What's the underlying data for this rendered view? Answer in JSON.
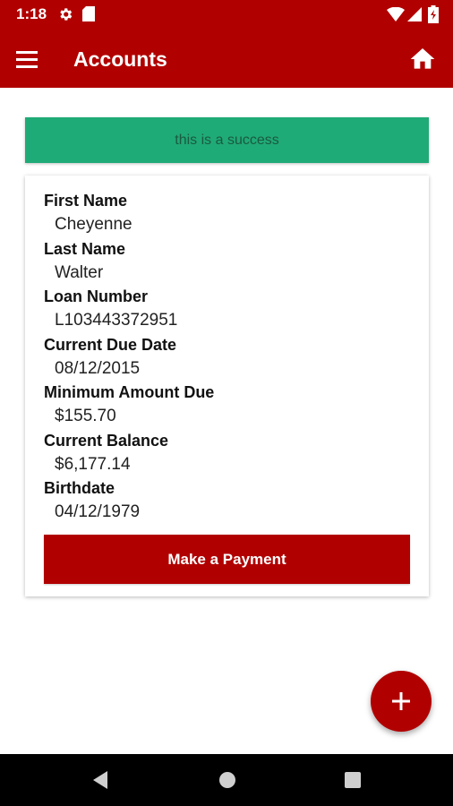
{
  "status_bar": {
    "time": "1:18",
    "icons": [
      "settings-gear-icon",
      "sd-card-icon",
      "wifi-icon",
      "cell-signal-icon",
      "battery-charging-icon"
    ]
  },
  "app_bar": {
    "title": "Accounts",
    "icons": [
      "menu-icon",
      "home-icon"
    ]
  },
  "alert": {
    "message": "this is a success",
    "color": "#1fab77"
  },
  "account": {
    "fields": [
      {
        "label": "First Name",
        "value": "Cheyenne"
      },
      {
        "label": "Last Name",
        "value": "Walter"
      },
      {
        "label": "Loan Number",
        "value": "L103443372951"
      },
      {
        "label": "Current Due Date",
        "value": "08/12/2015"
      },
      {
        "label": "Minimum Amount Due",
        "value": "$155.70"
      },
      {
        "label": "Current Balance",
        "value": "$6,177.14"
      },
      {
        "label": "Birthdate",
        "value": "04/12/1979"
      }
    ],
    "payment_button_label": "Make a Payment"
  },
  "fab": {
    "icon": "plus-icon"
  },
  "nav_bar": {
    "icons": [
      "back-icon",
      "home-circle-icon",
      "recents-icon"
    ]
  },
  "colors": {
    "brand": "#b10000",
    "success": "#1fab77"
  }
}
